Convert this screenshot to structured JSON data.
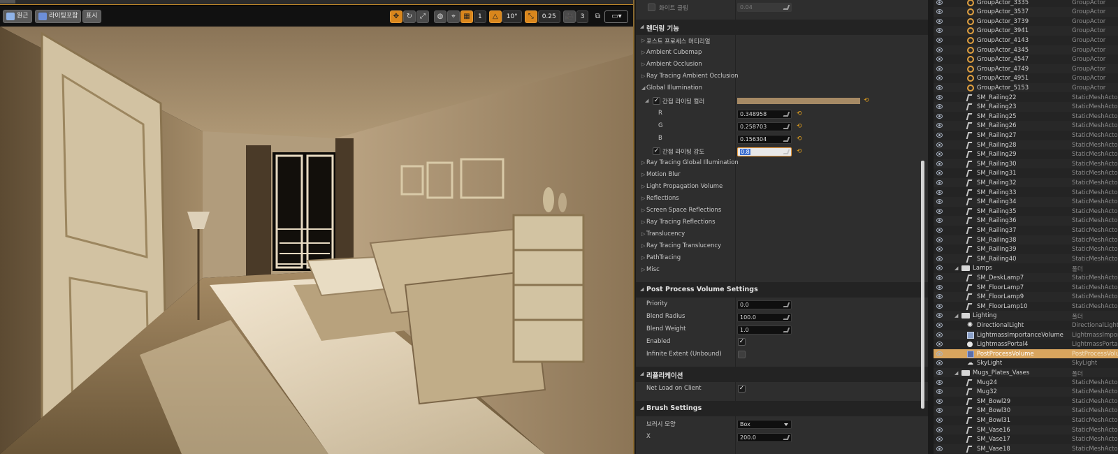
{
  "viewport": {
    "buttons": {
      "perspective": "원근",
      "lit": "라이팅포함",
      "show": "표시"
    },
    "toolbar": {
      "grid_snap": "1",
      "rotation_snap": "10°",
      "scale_snap": "0.25",
      "camera_speed": "3"
    }
  },
  "details": {
    "top_row": {
      "label": "화이트 클립",
      "value": "0.04"
    },
    "rendering_features": {
      "title": "렌더링 기능",
      "items": [
        "포스트 프로세스 머티리얼",
        "Ambient Cubemap",
        "Ambient Occlusion",
        "Ray Tracing Ambient Occlusion",
        "Global Illumination"
      ],
      "gi": {
        "indirect_color_label": "간접 라이팅 컬러",
        "r_label": "R",
        "r": "0.348958",
        "g_label": "G",
        "g": "0.258703",
        "b_label": "B",
        "b": "0.156304",
        "intensity_label": "간접 라이팅 강도",
        "intensity": "0.8"
      },
      "items_after": [
        "Ray Tracing Global Illumination",
        "Motion Blur",
        "Light Propagation Volume",
        "Reflections",
        "Screen Space Reflections",
        "Ray Tracing Reflections",
        "Translucency",
        "Ray Tracing Translucency",
        "PathTracing",
        "Misc"
      ]
    },
    "ppv_settings": {
      "title": "Post Process Volume Settings",
      "priority_label": "Priority",
      "priority": "0.0",
      "blend_radius_label": "Blend Radius",
      "blend_radius": "100.0",
      "blend_weight_label": "Blend Weight",
      "blend_weight": "1.0",
      "enabled_label": "Enabled",
      "infinite_label": "Infinite Extent (Unbound)"
    },
    "replication": {
      "title": "리플리케이션",
      "net_load_label": "Net Load on Client"
    },
    "brush": {
      "title": "Brush Settings",
      "shape_label": "브러시 모양",
      "shape": "Box",
      "x_label": "X",
      "x": "200.0"
    }
  },
  "outliner": {
    "rows": [
      {
        "name": "GroupActor_3335",
        "type": "GroupActor",
        "icon": "group-icon"
      },
      {
        "name": "GroupActor_3537",
        "type": "GroupActor",
        "icon": "group-icon"
      },
      {
        "name": "GroupActor_3739",
        "type": "GroupActor",
        "icon": "group-icon"
      },
      {
        "name": "GroupActor_3941",
        "type": "GroupActor",
        "icon": "group-icon"
      },
      {
        "name": "GroupActor_4143",
        "type": "GroupActor",
        "icon": "group-icon"
      },
      {
        "name": "GroupActor_4345",
        "type": "GroupActor",
        "icon": "group-icon"
      },
      {
        "name": "GroupActor_4547",
        "type": "GroupActor",
        "icon": "group-icon"
      },
      {
        "name": "GroupActor_4749",
        "type": "GroupActor",
        "icon": "group-icon"
      },
      {
        "name": "GroupActor_4951",
        "type": "GroupActor",
        "icon": "group-icon"
      },
      {
        "name": "GroupActor_5153",
        "type": "GroupActor",
        "icon": "group-icon"
      },
      {
        "name": "SM_Railing22",
        "type": "StaticMeshActor",
        "icon": "mesh-icon"
      },
      {
        "name": "SM_Railing23",
        "type": "StaticMeshActor",
        "icon": "mesh-icon"
      },
      {
        "name": "SM_Railing25",
        "type": "StaticMeshActor",
        "icon": "mesh-icon"
      },
      {
        "name": "SM_Railing26",
        "type": "StaticMeshActor",
        "icon": "mesh-icon"
      },
      {
        "name": "SM_Railing27",
        "type": "StaticMeshActor",
        "icon": "mesh-icon"
      },
      {
        "name": "SM_Railing28",
        "type": "StaticMeshActor",
        "icon": "mesh-icon"
      },
      {
        "name": "SM_Railing29",
        "type": "StaticMeshActor",
        "icon": "mesh-icon"
      },
      {
        "name": "SM_Railing30",
        "type": "StaticMeshActor",
        "icon": "mesh-icon"
      },
      {
        "name": "SM_Railing31",
        "type": "StaticMeshActor",
        "icon": "mesh-icon"
      },
      {
        "name": "SM_Railing32",
        "type": "StaticMeshActor",
        "icon": "mesh-icon"
      },
      {
        "name": "SM_Railing33",
        "type": "StaticMeshActor",
        "icon": "mesh-icon"
      },
      {
        "name": "SM_Railing34",
        "type": "StaticMeshActor",
        "icon": "mesh-icon"
      },
      {
        "name": "SM_Railing35",
        "type": "StaticMeshActor",
        "icon": "mesh-icon"
      },
      {
        "name": "SM_Railing36",
        "type": "StaticMeshActor",
        "icon": "mesh-icon"
      },
      {
        "name": "SM_Railing37",
        "type": "StaticMeshActor",
        "icon": "mesh-icon"
      },
      {
        "name": "SM_Railing38",
        "type": "StaticMeshActor",
        "icon": "mesh-icon"
      },
      {
        "name": "SM_Railing39",
        "type": "StaticMeshActor",
        "icon": "mesh-icon"
      },
      {
        "name": "SM_Railing40",
        "type": "StaticMeshActor",
        "icon": "mesh-icon"
      },
      {
        "name": "Lamps",
        "type": "폴더",
        "icon": "folder-icon",
        "folder": true
      },
      {
        "name": "SM_DeskLamp7",
        "type": "StaticMeshActor",
        "icon": "mesh-icon"
      },
      {
        "name": "SM_FloorLamp7",
        "type": "StaticMeshActor",
        "icon": "mesh-icon"
      },
      {
        "name": "SM_FloorLamp9",
        "type": "StaticMeshActor",
        "icon": "mesh-icon"
      },
      {
        "name": "SM_FloorLamp10",
        "type": "StaticMeshActor",
        "icon": "mesh-icon"
      },
      {
        "name": "Lighting",
        "type": "폴더",
        "icon": "folder-icon",
        "folder": true
      },
      {
        "name": "DirectionalLight",
        "type": "DirectionalLight",
        "icon": "directional-light-icon"
      },
      {
        "name": "LightmassImportanceVolume",
        "type": "LightmassImporta",
        "icon": "volume-icon"
      },
      {
        "name": "LightmassPortal4",
        "type": "LightmassPortal",
        "icon": "portal-icon"
      },
      {
        "name": "PostProcessVolume",
        "type": "PostProcessVolu",
        "icon": "post-process-volume-icon",
        "selected": true
      },
      {
        "name": "SkyLight",
        "type": "SkyLight",
        "icon": "skylight-icon"
      },
      {
        "name": "Mugs_Plates_Vases",
        "type": "폴더",
        "icon": "folder-icon",
        "folder": true
      },
      {
        "name": "Mug24",
        "type": "StaticMeshActor",
        "icon": "mesh-icon"
      },
      {
        "name": "Mug32",
        "type": "StaticMeshActor",
        "icon": "mesh-icon"
      },
      {
        "name": "SM_Bowl29",
        "type": "StaticMeshActor",
        "icon": "mesh-icon"
      },
      {
        "name": "SM_Bowl30",
        "type": "StaticMeshActor",
        "icon": "mesh-icon"
      },
      {
        "name": "SM_Bowl31",
        "type": "StaticMeshActor",
        "icon": "mesh-icon"
      },
      {
        "name": "SM_Vase16",
        "type": "StaticMeshActor",
        "icon": "mesh-icon"
      },
      {
        "name": "SM_Vase17",
        "type": "StaticMeshActor",
        "icon": "mesh-icon"
      },
      {
        "name": "SM_Vase18",
        "type": "StaticMeshActor",
        "icon": "mesh-icon"
      }
    ]
  }
}
